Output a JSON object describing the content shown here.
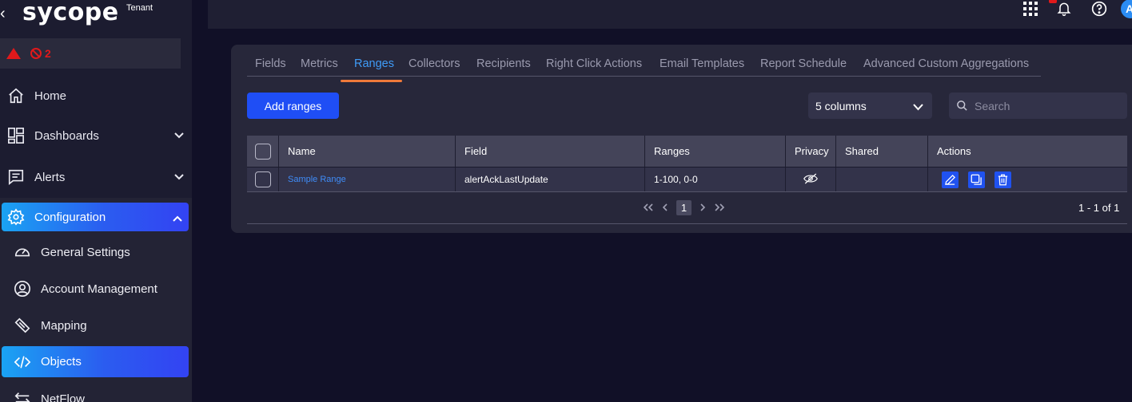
{
  "brand": {
    "logo_text": "sycope",
    "tenant": "Tenant"
  },
  "alerts": {
    "count": "2"
  },
  "sidebar": {
    "home": "Home",
    "dashboards": "Dashboards",
    "alerts": "Alerts",
    "configuration": "Configuration",
    "sub": {
      "general_settings": "General Settings",
      "account_management": "Account Management",
      "mapping": "Mapping",
      "objects": "Objects",
      "netflow": "NetFlow"
    }
  },
  "topbar": {
    "avatar_initial": "A"
  },
  "tabs": [
    "Fields",
    "Metrics",
    "Ranges",
    "Collectors",
    "Recipients",
    "Right Click Actions",
    "Email Templates",
    "Report Schedule",
    "Advanced Custom Aggregations"
  ],
  "toolbar": {
    "add_label": "Add ranges",
    "columns_select": "5 columns",
    "search_placeholder": "Search"
  },
  "table": {
    "headers": {
      "name": "Name",
      "field": "Field",
      "ranges": "Ranges",
      "privacy": "Privacy",
      "shared": "Shared",
      "actions": "Actions"
    },
    "rows": [
      {
        "name": "Sample Range",
        "field": "alertAckLastUpdate",
        "ranges": "1-100, 0-0",
        "privacy": "hidden",
        "shared": ""
      }
    ]
  },
  "pagination": {
    "current_page": "1",
    "range_text": "1 - 1 of 1"
  },
  "colors": {
    "accent": "#1f4ef5",
    "tab_active": "#3f9cf8",
    "underline": "#f07a3a",
    "alert": "#e0191b"
  }
}
